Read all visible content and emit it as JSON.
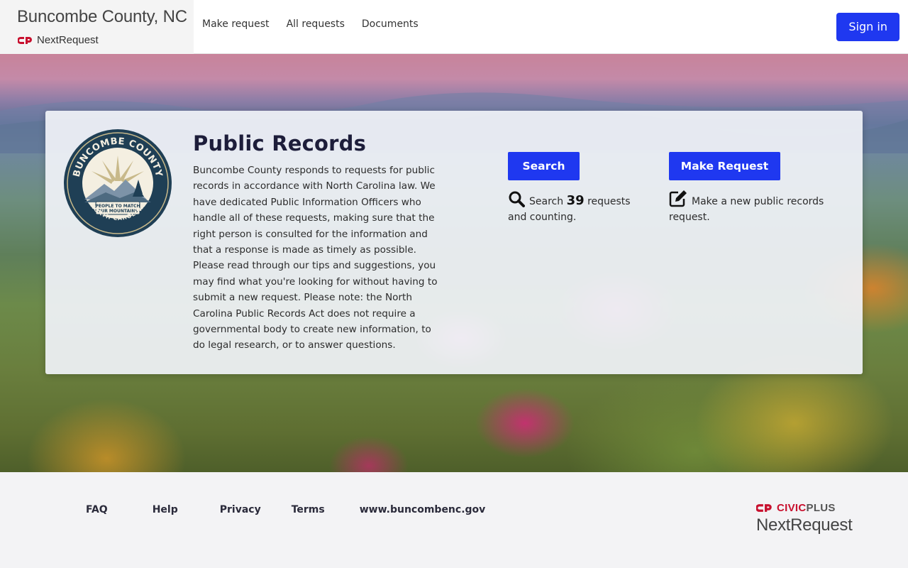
{
  "header": {
    "org_title": "Buncombe County, NC",
    "product_name": "NextRequest",
    "nav": [
      "Make request",
      "All requests",
      "Documents"
    ],
    "sign_in": "Sign in"
  },
  "hero": {
    "title": "Public Records",
    "description": "Buncombe County responds to requests for public records in accordance with North Carolina law. We have dedicated Public Information Officers who handle all of these requests, making sure that the right person is consulted for the information and that a response is made as timely as possible. Please read through our tips and suggestions, you may find what you're looking for without having to submit a new request. Please note: the North Carolina Public Records Act does not require a governmental body to create new information, to do legal research, or to answer questions.",
    "seal": {
      "top": "BUNCOMBE COUNTY",
      "banner_line1": "PEOPLE TO MATCH",
      "banner_line2": "OUR MOUNTAINS",
      "bottom": "NORTH CAROLINA"
    },
    "search_button": "Search",
    "search_note_prefix": "Search",
    "search_count": "39",
    "search_note_suffix": "requests and counting.",
    "make_button": "Make Request",
    "make_note": "Make a new public records request."
  },
  "footer": {
    "links": [
      "FAQ",
      "Help",
      "Privacy",
      "Terms",
      "www.buncombenc.gov"
    ],
    "brand_civic": "CIVIC",
    "brand_plus": "PLUS",
    "brand_next": "NextRequest"
  },
  "colors": {
    "primary_button": "#1f38f0",
    "brand_red": "#c8102e",
    "seal_navy": "#1f3f55",
    "seal_gold": "#c8b98a"
  },
  "icons": [
    "civicplus-logo-icon",
    "search-icon",
    "edit-icon",
    "county-seal-icon"
  ]
}
